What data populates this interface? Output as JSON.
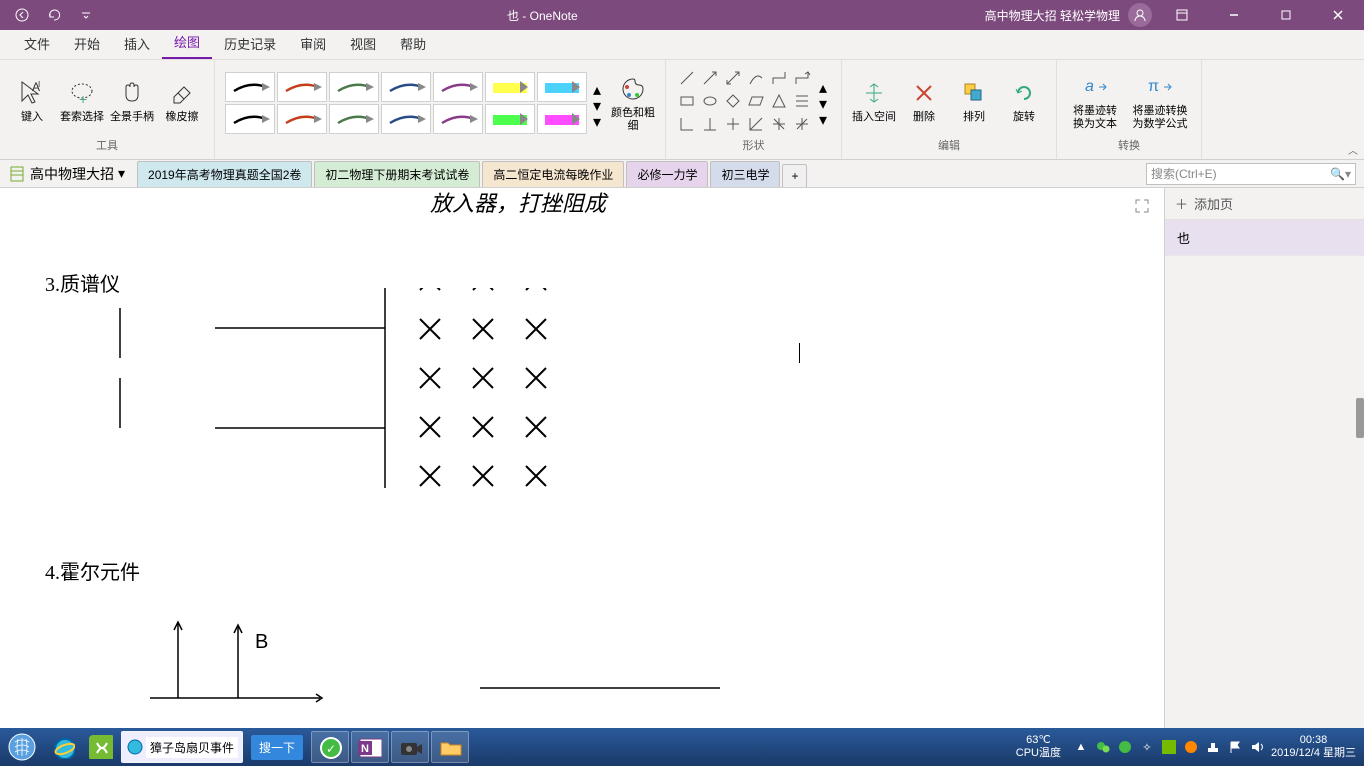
{
  "app": {
    "title": "也  -  OneNote",
    "subtitle": "高中物理大招 轻松学物理"
  },
  "ribbon_tabs": [
    "文件",
    "开始",
    "插入",
    "绘图",
    "历史记录",
    "审阅",
    "视图",
    "帮助"
  ],
  "ribbon_active": 3,
  "tools": {
    "type_btn": "键入",
    "lasso": "套索选择",
    "pan": "全景手柄",
    "eraser": "橡皮擦",
    "group_tools": "工具",
    "color_thick": "颜色和粗细",
    "group_shapes": "形状",
    "insert_space": "插入空间",
    "delete": "删除",
    "arrange": "排列",
    "rotate": "旋转",
    "group_edit": "编辑",
    "ink_to_text": "将墨迹转\n换为文本",
    "ink_to_math": "将墨迹转换\n为数学公式",
    "group_convert": "转换"
  },
  "pen_colors_row1": [
    "#000000",
    "#c43e1c",
    "#4a7a4a",
    "#2a4a8a",
    "#8a3a8a",
    "#ffff00",
    "#00bfff"
  ],
  "pen_colors_row2": [
    "#000000",
    "#c43e1c",
    "#4a7a4a",
    "#2a4a8a",
    "#8a3a8a",
    "#00ff00",
    "#ff00ff"
  ],
  "notebook": {
    "name": "高中物理大招"
  },
  "sections": [
    "2019年高考物理真题全国2卷",
    "初二物理下册期末考试试卷",
    "高二恒定电流每晚作业",
    "必修一力学",
    "初三电学"
  ],
  "section_add": "+",
  "search": {
    "placeholder": "搜索(Ctrl+E)"
  },
  "pages": {
    "add": "添加页",
    "items": [
      "也"
    ]
  },
  "content": {
    "ink_top": "放入器，打挫阻成",
    "h3": "3.质谱仪",
    "h4": "4.霍尔元件",
    "b_label": "B"
  },
  "taskbar": {
    "ie_page": "獐子岛扇贝事件",
    "sogou": "搜一下",
    "temp": "63℃",
    "temp_label": "CPU温度",
    "time": "00:38",
    "date": "2019/12/4 星期三"
  }
}
